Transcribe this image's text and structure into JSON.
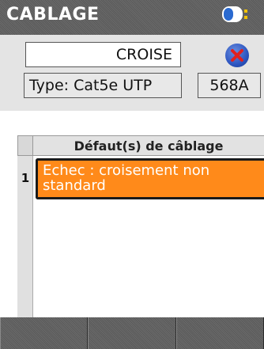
{
  "header": {
    "title": "CABLAGE",
    "battery_icon": "battery-icon"
  },
  "wire_result": {
    "value": "CROISE"
  },
  "close_button": {
    "icon": "close-icon",
    "accent": "#2d55c0",
    "x_color": "#e02020"
  },
  "cable_type": {
    "value": "Type: Cat5e UTP"
  },
  "wiring_standard": {
    "value": "568A"
  },
  "faults_table": {
    "header": "Défaut(s) de câblage",
    "rows": [
      {
        "number": "1",
        "text": "Echec : croisement non standard"
      }
    ]
  },
  "softkeys": [
    {
      "label": ""
    },
    {
      "label": ""
    },
    {
      "label": ""
    }
  ],
  "colors": {
    "title_bar": "#606060",
    "fault_highlight": "#ff8a1a",
    "panel": "#e4e4e4"
  }
}
